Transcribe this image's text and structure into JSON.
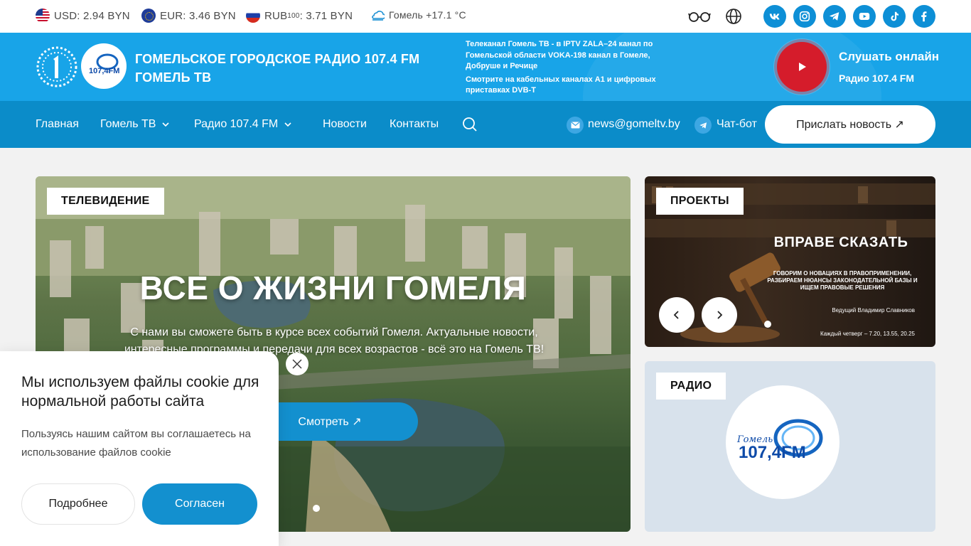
{
  "topbar": {
    "rates": [
      {
        "label": "USD: 2.94 BYN"
      },
      {
        "label": "EUR: 3.46 BYN"
      },
      {
        "label_main": "RUB",
        "label_sup": "100",
        "label_rest": ": 3.71 BYN"
      }
    ],
    "weather": "Гомель +17.1 °C",
    "social": [
      "vk-icon",
      "instagram-icon",
      "telegram-icon",
      "youtube-icon",
      "tiktok-icon",
      "facebook-icon"
    ]
  },
  "header": {
    "title_line1": "ГОМЕЛЬСКОЕ ГОРОДСКОЕ РАДИО 107.4 FM",
    "title_line2": "ГОМЕЛЬ ТВ",
    "promo1": "Телеканал Гомель ТВ - в IPTV ZALA–24 канал по Гомельской области VOKA-198 канал в Гомеле, Добруше и Речице",
    "promo2": "Смотрите на кабельных каналах А1 и цифровых приставках DVB-T",
    "listen_title": "Слушать онлайн",
    "listen_sub": "Радио 107.4 FM"
  },
  "nav": {
    "items": [
      "Главная",
      "Гомель ТВ",
      "Радио 107.4 FM",
      "Новости",
      "Контакты"
    ],
    "email": "news@gomeltv.by",
    "chatbot": "Чат-бот",
    "send_news": "Прислать новость ↗"
  },
  "hero": {
    "tag": "ТЕЛЕВИДЕНИЕ",
    "title": "ВСЕ О ЖИЗНИ ГОМЕЛЯ",
    "text": "С нами вы сможете быть в курсе всех событий Гомеля. Актуальные новости, интересные программы и передачи для всех возрастов - всё это на Гомель ТВ!",
    "button": "Смотреть ↗"
  },
  "projects": {
    "tag": "ПРОЕКТЫ",
    "title": "ВПРАВЕ СКАЗАТЬ",
    "desc": "ГОВОРИМ О НОВАЦИЯХ В ПРАВОПРИМЕНЕНИИ, РАЗБИРАЕМ НЮАНСЫ ЗАКОНОДАТЕЛЬНОЙ БАЗЫ И ИЩЕМ ПРАВОВЫЕ РЕШЕНИЯ",
    "host": "Ведущий Владимир Славников",
    "time": "Каждый четверг – 7.20, 13.55, 20.25"
  },
  "radio": {
    "tag": "РАДИО",
    "logo_small": "Гомель",
    "logo_big": "107,4FM"
  },
  "cookie": {
    "title": "Мы используем файлы cookie для нормальной работы сайта",
    "text": "Пользуясь нашим сайтом вы соглашаетесь на использование файлов cookie",
    "more": "Подробнее",
    "agree": "Согласен"
  },
  "colors": {
    "brand_blue": "#18a4e8",
    "nav_blue": "#0b8cc9",
    "accent_red": "#d51c2b"
  }
}
